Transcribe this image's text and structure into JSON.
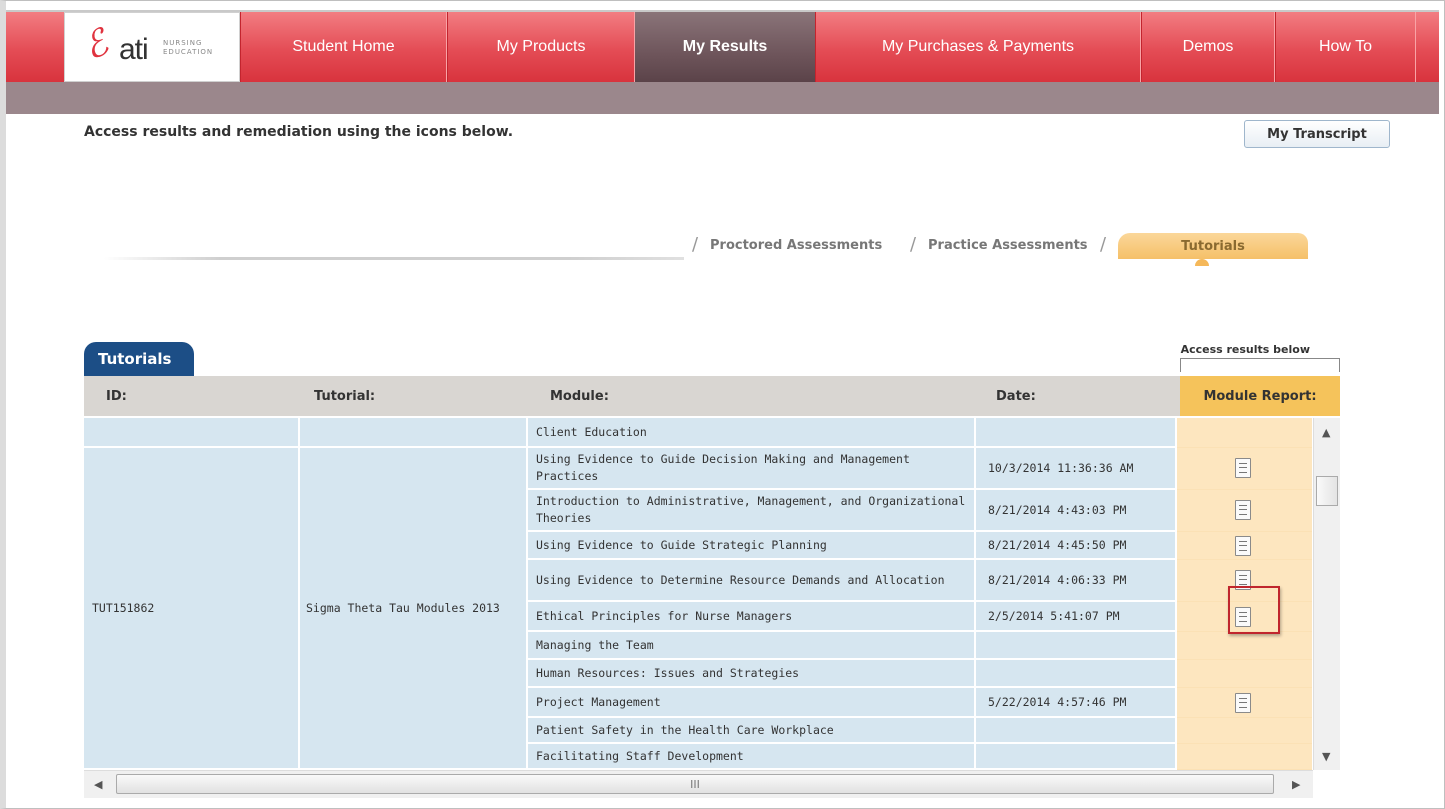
{
  "nav": {
    "logo_text": "ati",
    "logo_sub": "NURSING EDUCATION",
    "items": [
      "Student Home",
      "My Products",
      "My Results",
      "My Purchases & Payments",
      "Demos",
      "How To"
    ],
    "active": "My Results"
  },
  "intro": "Access results and remediation using the icons below.",
  "transcript_button": "My Transcript",
  "page_tabs": [
    "Proctored Assessments",
    "Practice Assessments",
    "Tutorials"
  ],
  "section_title": "Tutorials",
  "access_note": "Access results below",
  "table": {
    "headers": {
      "id": "ID:",
      "tutorial": "Tutorial:",
      "module": "Module:",
      "date": "Date:",
      "report": "Module Report:"
    },
    "group": {
      "id": "TUT151862",
      "tutorial": "Sigma Theta Tau Modules 2013"
    },
    "rows": [
      {
        "module": "Client Education",
        "date": "",
        "report": false
      },
      {
        "module": "Using Evidence to Guide Decision Making and Management Practices",
        "date": "10/3/2014 11:36:36 AM",
        "report": true
      },
      {
        "module": "Introduction to Administrative, Management, and Organizational Theories",
        "date": "8/21/2014 4:43:03 PM",
        "report": true
      },
      {
        "module": "Using Evidence to Guide Strategic Planning",
        "date": "8/21/2014 4:45:50 PM",
        "report": true
      },
      {
        "module": "Using Evidence to Determine Resource Demands and Allocation",
        "date": "8/21/2014 4:06:33 PM",
        "report": true
      },
      {
        "module": "Ethical Principles for Nurse Managers",
        "date": "2/5/2014 5:41:07 PM",
        "report": true
      },
      {
        "module": "Managing the Team",
        "date": "",
        "report": false
      },
      {
        "module": "Human Resources: Issues and Strategies",
        "date": "",
        "report": false
      },
      {
        "module": "Project Management",
        "date": "5/22/2014 4:57:46 PM",
        "report": true
      },
      {
        "module": "Patient Safety in the Health Care Workplace",
        "date": "",
        "report": false
      },
      {
        "module": "Facilitating Staff Development",
        "date": "",
        "report": false
      }
    ]
  },
  "scroll_grip": "III",
  "colors": {
    "nav_red": "#e44c55",
    "active_tab": "#6e555b",
    "tutorial_tab": "#f5c068",
    "table_blue": "#d6e6f0",
    "report_col": "#fde6bf",
    "label_navy": "#1c4e86"
  }
}
